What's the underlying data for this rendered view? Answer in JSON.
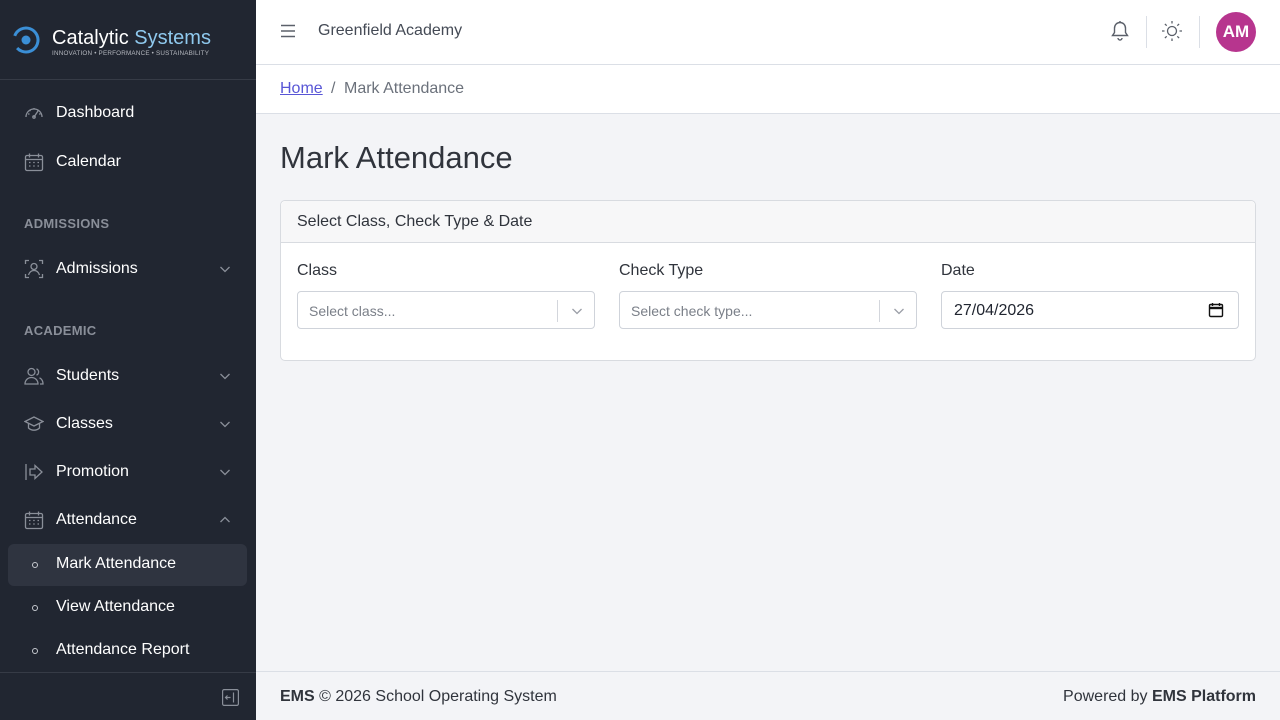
{
  "brand": {
    "name_part1": "Catalytic",
    "name_part2": "Systems",
    "tagline": "INNOVATION • PERFORMANCE • SUSTAINABILITY",
    "accent_color": "#8fc9ee"
  },
  "sidebar": {
    "items": [
      {
        "label": "Dashboard",
        "icon": "speedometer-icon"
      },
      {
        "label": "Calendar",
        "icon": "calendar-icon"
      }
    ],
    "sections": [
      {
        "title": "ADMISSIONS"
      },
      {
        "title": "ACADEMIC"
      }
    ],
    "admissions": {
      "label": "Admissions",
      "icon": "person-badge-icon"
    },
    "academic_items": [
      {
        "label": "Students",
        "icon": "people-icon"
      },
      {
        "label": "Classes",
        "icon": "mortarboard-icon"
      },
      {
        "label": "Promotion",
        "icon": "arrow-right-icon"
      },
      {
        "label": "Attendance",
        "icon": "calendar-icon",
        "expanded": true
      }
    ],
    "attendance_sub": [
      {
        "label": "Mark Attendance",
        "active": true
      },
      {
        "label": "View Attendance",
        "active": false
      },
      {
        "label": "Attendance Report",
        "active": false
      }
    ]
  },
  "header": {
    "school_name": "Greenfield Academy",
    "avatar_initials": "AM",
    "avatar_color": "#b7358e"
  },
  "breadcrumb": {
    "home": "Home",
    "separator": "/",
    "current": "Mark Attendance"
  },
  "main": {
    "page_title": "Mark Attendance",
    "card_title": "Select Class, Check Type & Date",
    "class_label": "Class",
    "class_placeholder": "Select class...",
    "check_type_label": "Check Type",
    "check_type_placeholder": "Select check type...",
    "date_label": "Date",
    "date_value": "27/04/2026"
  },
  "footer": {
    "left_brand": "EMS",
    "left_text": " © 2026 School Operating System",
    "right_prefix": "Powered by ",
    "right_brand": "EMS Platform"
  }
}
